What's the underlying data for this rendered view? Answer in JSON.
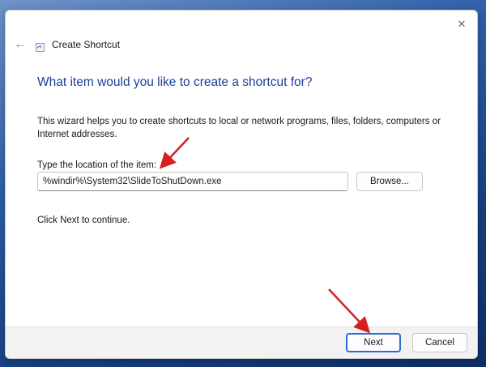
{
  "window": {
    "title": "Create Shortcut",
    "close_glyph": "✕",
    "back_glyph": "←"
  },
  "wizard": {
    "heading": "What item would you like to create a shortcut for?",
    "intro": "This wizard helps you to create shortcuts to local or network programs, files, folders, computers or Internet addresses.",
    "location_label": "Type the location of the item:",
    "location_value": "%windir%\\System32\\SlideToShutDown.exe",
    "browse_label": "Browse...",
    "continue_text": "Click Next to continue."
  },
  "footer": {
    "next_label": "Next",
    "cancel_label": "Cancel"
  },
  "colors": {
    "heading": "#1a3f9b",
    "annotation_arrow": "#d42020",
    "focus_border": "#2e6bd4"
  },
  "icons": {
    "back": "back-arrow-icon",
    "close": "close-icon",
    "app": "shortcut-icon"
  }
}
